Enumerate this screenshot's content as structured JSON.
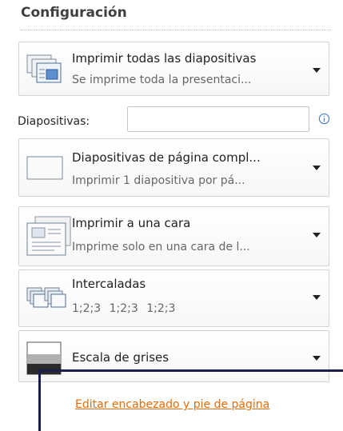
{
  "section": {
    "title": "Configuración"
  },
  "print_what": {
    "main": "Imprimir todas las diapositivas",
    "sub": "Se imprime toda la presentaci...",
    "icon": "slides-stack-icon"
  },
  "slides": {
    "label": "Diapositivas:",
    "value": "",
    "placeholder": "",
    "info_icon": "info-icon"
  },
  "layout": {
    "main": "Diapositivas de página compl...",
    "sub": "Imprimir 1 diapositiva por pá...",
    "icon": "full-page-slide-icon"
  },
  "sides": {
    "main": "Imprimir a una cara",
    "sub": "Imprime solo en una cara de l...",
    "icon": "one-sided-page-icon"
  },
  "collation": {
    "main": "Intercaladas",
    "sub": "1;2;3   1;2;3   1;2;3",
    "icon": "collated-pages-icon"
  },
  "color": {
    "main": "Escala de grises",
    "icon": "grayscale-icon"
  },
  "footer_link": {
    "label": "Editar encabezado y pie de página"
  },
  "colors": {
    "link": "#e46c0a",
    "overlay": "#1b1f4e"
  }
}
